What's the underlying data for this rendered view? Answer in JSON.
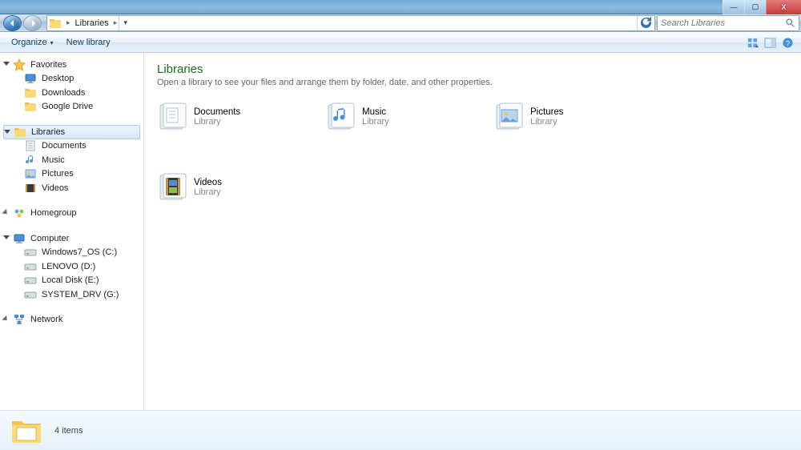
{
  "titlebar": {
    "min": "—",
    "max": "▢",
    "close": "X"
  },
  "address": {
    "location": "Libraries",
    "crumb_sep": "▸",
    "search_placeholder": "Search Libraries"
  },
  "toolbar": {
    "organize": "Organize",
    "organize_arrow": "▾",
    "new_library": "New library"
  },
  "nav": {
    "favorites": {
      "label": "Favorites",
      "items": [
        "Desktop",
        "Downloads",
        "Google Drive"
      ]
    },
    "libraries": {
      "label": "Libraries",
      "items": [
        "Documents",
        "Music",
        "Pictures",
        "Videos"
      ]
    },
    "homegroup": {
      "label": "Homegroup"
    },
    "computer": {
      "label": "Computer",
      "items": [
        "Windows7_OS (C:)",
        "LENOVO (D:)",
        "Local Disk (E:)",
        "SYSTEM_DRV (G:)"
      ]
    },
    "network": {
      "label": "Network"
    }
  },
  "content": {
    "title": "Libraries",
    "subtitle": "Open a library to see your files and arrange them by folder, date, and other properties.",
    "item_type": "Library",
    "items": [
      "Documents",
      "Music",
      "Pictures",
      "Videos"
    ]
  },
  "status": {
    "count": "4 items"
  }
}
